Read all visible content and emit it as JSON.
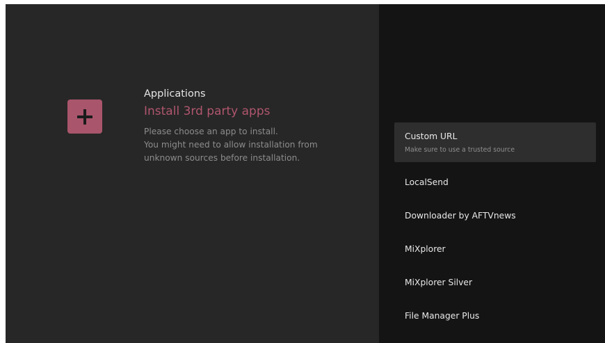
{
  "colors": {
    "accent": "#b0566e",
    "icon_bg": "#a9566c"
  },
  "header": {
    "breadcrumb": "Applications",
    "title": "Install 3rd party apps",
    "description": [
      "Please choose an app to install.",
      "You might need to allow installation from",
      "unknown sources before installation."
    ],
    "icon": "plus-icon"
  },
  "list": {
    "items": [
      {
        "label": "Custom URL",
        "subtitle": "Make sure to use a trusted source",
        "focused": true
      },
      {
        "label": "LocalSend"
      },
      {
        "label": "Downloader by AFTVnews"
      },
      {
        "label": "MiXplorer"
      },
      {
        "label": "MiXplorer Silver"
      },
      {
        "label": "File Manager Plus"
      }
    ]
  }
}
